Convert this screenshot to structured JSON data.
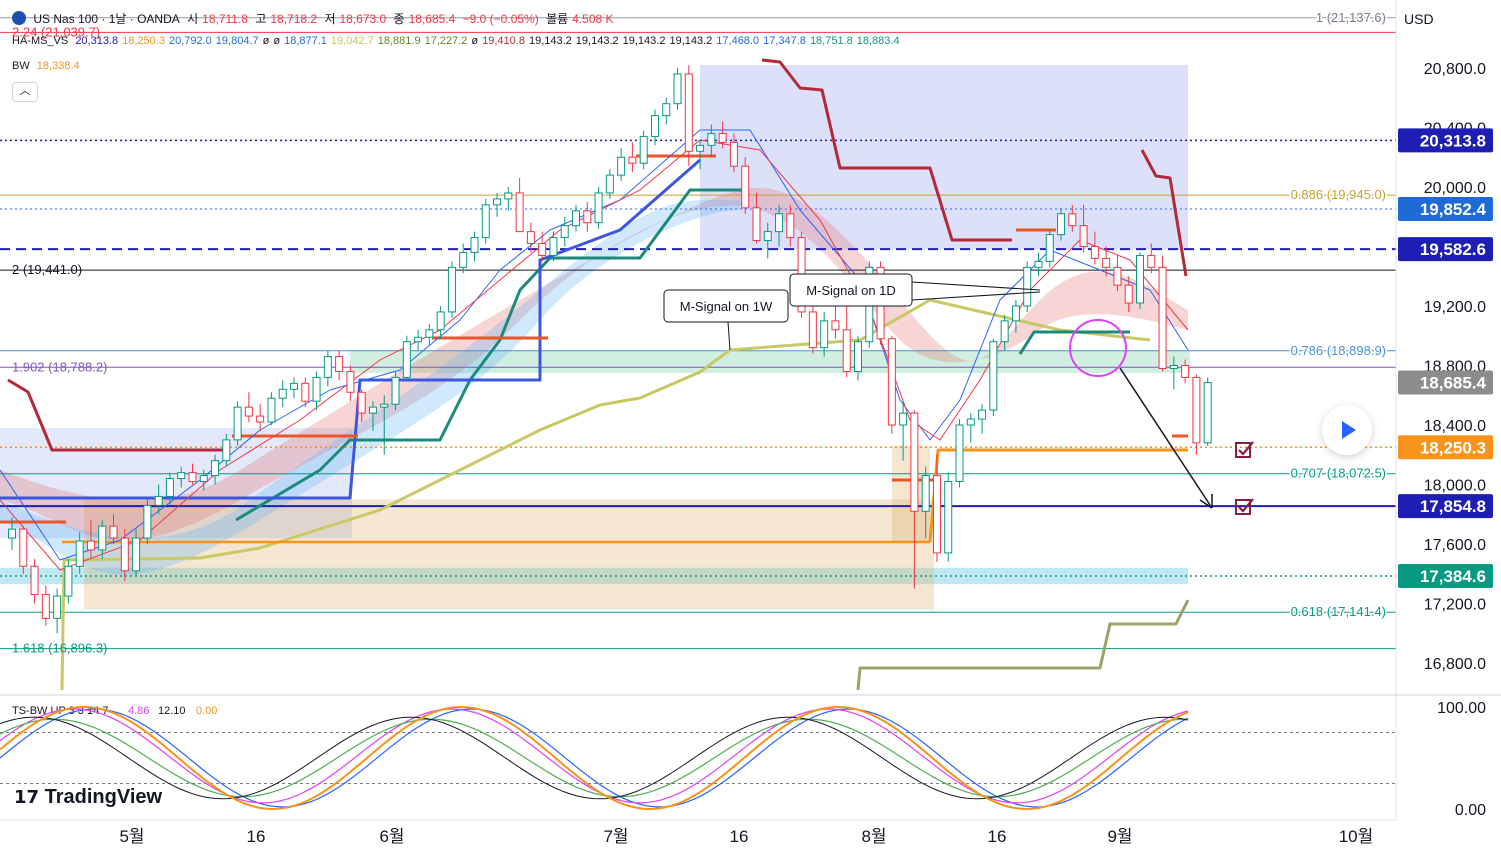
{
  "header": {
    "symbol": "US Nas 100 · 1날 · OANDA",
    "ohlc": [
      {
        "label": "시",
        "value": "18,711.8"
      },
      {
        "label": "고",
        "value": "18,718.2"
      },
      {
        "label": "저",
        "value": "18,673.0"
      },
      {
        "label": "종",
        "value": "18,685.4"
      }
    ],
    "change": "−9.0 (−0.05%)",
    "volume_label": "볼륨",
    "volume": "4.508 K",
    "indicator_rows": [
      {
        "name": "HA-MS_VS",
        "values": [
          "20,313.8",
          "18,250.3",
          "20,792.0",
          "19,804.7",
          "ø",
          "ø",
          "18,877.1",
          "19,042.7",
          "18,881.9",
          "17,227.2",
          "ø",
          "19,410.8",
          "19,143.2",
          "19,143.2",
          "19,143.2",
          "19,143.2",
          "17,468.0",
          "17,347.8",
          "18,751.8",
          "18,883.4"
        ]
      },
      {
        "name": "BW",
        "values": [
          "18,338.4"
        ]
      }
    ]
  },
  "currency": "USD",
  "logo_text": "TradingView",
  "colors": {
    "up": "#089981",
    "down": "#f23645",
    "blue_line": "#2962ff",
    "navy": "#1e1eb4",
    "orange": "#f7931a",
    "olive": "#c8c864",
    "teal": "#1b8a7a",
    "darkred": "#b22a38",
    "magenta": "#e040fb"
  },
  "chart_data": [
    {
      "type": "candlestick",
      "title": "US Nas 100 · 1날 · OANDA",
      "ylim": [
        16600,
        21200
      ],
      "x_tick_labels": [
        "5월",
        "16",
        "6월",
        "7월",
        "16",
        "8월",
        "16",
        "9월",
        "10월"
      ],
      "y_tick_labels": [
        "20,800.0",
        "20,400.0",
        "20,000.0",
        "19,200.0",
        "18,800.0",
        "18,400.0",
        "18,000.0",
        "17,600.0",
        "17,200.0",
        "16,800.0"
      ],
      "y_ticks": [
        20800,
        20400,
        20000,
        19200,
        18800,
        18400,
        18000,
        17600,
        17200,
        16800
      ],
      "price_tags": [
        {
          "label": "20,313.8",
          "value": 20313.8,
          "color": "#1e1eb4"
        },
        {
          "label": "19,852.4",
          "value": 19852.4,
          "color": "#1e6bd6"
        },
        {
          "label": "19,582.6",
          "value": 19582.6,
          "color": "#1e1eb4"
        },
        {
          "label": "18,685.4",
          "value": 18685.4,
          "color": "#8c8c8c"
        },
        {
          "label": "18,250.3",
          "value": 18250.3,
          "color": "#f7931a"
        },
        {
          "label": "17,854.8",
          "value": 17854.8,
          "color": "#1e1eb4"
        },
        {
          "label": "17,384.6",
          "value": 17384.6,
          "color": "#089981"
        }
      ],
      "fib_labels": [
        {
          "label": "1 (21,137.6)",
          "value": 21137.6
        },
        {
          "label": "2.24 (21,039.7)",
          "value": 21039.7
        },
        {
          "label": "0.886 (19,945.0)",
          "value": 19945.0
        },
        {
          "label": "2 (19,441.0)",
          "value": 19441.0
        },
        {
          "label": "0.786 (18,898.9)",
          "value": 18898.9
        },
        {
          "label": "1.902 (18,788.2)",
          "value": 18788.2
        },
        {
          "label": "0.707 (18,072.5)",
          "value": 18072.5
        },
        {
          "label": "0.618 (17,141.4)",
          "value": 17141.4
        },
        {
          "label": "1.618 (16,896.3)",
          "value": 16896.3
        }
      ],
      "annotations": [
        "M-Signal on 1W",
        "M-Signal on 1D"
      ],
      "candles": [
        [
          17640,
          17780,
          17560,
          17700
        ],
        [
          17700,
          17720,
          17400,
          17450
        ],
        [
          17450,
          17500,
          17200,
          17260
        ],
        [
          17260,
          17320,
          17050,
          17100
        ],
        [
          17100,
          17300,
          17000,
          17250
        ],
        [
          17250,
          17500,
          17200,
          17450
        ],
        [
          17450,
          17680,
          17400,
          17620
        ],
        [
          17620,
          17760,
          17500,
          17560
        ],
        [
          17560,
          17760,
          17500,
          17720
        ],
        [
          17720,
          17800,
          17600,
          17640
        ],
        [
          17640,
          17700,
          17350,
          17420
        ],
        [
          17420,
          17700,
          17380,
          17640
        ],
        [
          17640,
          17900,
          17600,
          17860
        ],
        [
          17860,
          18000,
          17800,
          17920
        ],
        [
          17920,
          18080,
          17860,
          18040
        ],
        [
          18040,
          18120,
          17980,
          18080
        ],
        [
          18080,
          18140,
          18000,
          18020
        ],
        [
          18020,
          18100,
          17960,
          18060
        ],
        [
          18060,
          18200,
          18000,
          18160
        ],
        [
          18160,
          18340,
          18120,
          18300
        ],
        [
          18300,
          18560,
          18260,
          18520
        ],
        [
          18520,
          18620,
          18420,
          18460
        ],
        [
          18460,
          18540,
          18360,
          18420
        ],
        [
          18420,
          18620,
          18400,
          18580
        ],
        [
          18580,
          18700,
          18520,
          18640
        ],
        [
          18640,
          18720,
          18580,
          18680
        ],
        [
          18680,
          18720,
          18520,
          18560
        ],
        [
          18560,
          18760,
          18500,
          18720
        ],
        [
          18720,
          18900,
          18660,
          18860
        ],
        [
          18860,
          18900,
          18700,
          18760
        ],
        [
          18760,
          18800,
          18560,
          18620
        ],
        [
          18620,
          18640,
          18420,
          18480
        ],
        [
          18480,
          18560,
          18360,
          18520
        ],
        [
          18520,
          18600,
          18200,
          18540
        ],
        [
          18540,
          18760,
          18500,
          18720
        ],
        [
          18720,
          19000,
          18700,
          18960
        ],
        [
          18960,
          19040,
          18900,
          18990
        ],
        [
          18990,
          19080,
          18940,
          19040
        ],
        [
          19040,
          19200,
          18980,
          19160
        ],
        [
          19160,
          19500,
          19120,
          19460
        ],
        [
          19460,
          19620,
          19420,
          19560
        ],
        [
          19560,
          19700,
          19500,
          19660
        ],
        [
          19660,
          19920,
          19620,
          19880
        ],
        [
          19880,
          19960,
          19800,
          19920
        ],
        [
          19920,
          20000,
          19840,
          19960
        ],
        [
          19960,
          20060,
          19880,
          19700
        ],
        [
          19700,
          19760,
          19560,
          19620
        ],
        [
          19620,
          19700,
          19500,
          19540
        ],
        [
          19540,
          19700,
          19500,
          19660
        ],
        [
          19660,
          19800,
          19600,
          19740
        ],
        [
          19740,
          19880,
          19700,
          19840
        ],
        [
          19840,
          19900,
          19700,
          19760
        ],
        [
          19760,
          20000,
          19720,
          19960
        ],
        [
          19960,
          20120,
          19920,
          20080
        ],
        [
          20080,
          20260,
          20040,
          20200
        ],
        [
          20200,
          20300,
          20100,
          20160
        ],
        [
          20160,
          20380,
          20120,
          20340
        ],
        [
          20340,
          20520,
          20280,
          20480
        ],
        [
          20480,
          20600,
          20420,
          20560
        ],
        [
          20560,
          20800,
          20520,
          20760
        ],
        [
          20760,
          20820,
          20140,
          20240
        ],
        [
          20240,
          20320,
          20120,
          20280
        ],
        [
          20280,
          20420,
          20200,
          20360
        ],
        [
          20360,
          20440,
          20260,
          20300
        ],
        [
          20300,
          20360,
          20100,
          20140
        ],
        [
          20140,
          20200,
          19820,
          19860
        ],
        [
          19860,
          19960,
          19620,
          19640
        ],
        [
          19640,
          19760,
          19520,
          19700
        ],
        [
          19700,
          19880,
          19600,
          19820
        ],
        [
          19820,
          19880,
          19600,
          19660
        ],
        [
          19660,
          19700,
          19120,
          19160
        ],
        [
          19160,
          19220,
          18880,
          18920
        ],
        [
          18920,
          19160,
          18860,
          19100
        ],
        [
          19100,
          19260,
          18980,
          19040
        ],
        [
          19040,
          19200,
          18720,
          18760
        ],
        [
          18760,
          19000,
          18700,
          18960
        ],
        [
          18960,
          19500,
          18920,
          19460
        ],
        [
          19460,
          19500,
          18940,
          18980
        ],
        [
          18980,
          19000,
          18340,
          18400
        ],
        [
          18400,
          18560,
          18160,
          18480
        ],
        [
          18480,
          18500,
          17300,
          17820
        ],
        [
          17820,
          18120,
          17640,
          18060
        ],
        [
          18060,
          18200,
          17480,
          17540
        ],
        [
          17540,
          18080,
          17480,
          18020
        ],
        [
          18020,
          18440,
          17980,
          18400
        ],
        [
          18400,
          18480,
          18280,
          18440
        ],
        [
          18440,
          18540,
          18340,
          18500
        ],
        [
          18500,
          18980,
          18460,
          18960
        ],
        [
          18960,
          19140,
          18900,
          19100
        ],
        [
          19100,
          19240,
          19020,
          19200
        ],
        [
          19200,
          19500,
          19160,
          19460
        ],
        [
          19460,
          19560,
          19400,
          19500
        ],
        [
          19500,
          19720,
          19460,
          19680
        ],
        [
          19680,
          19860,
          19640,
          19820
        ],
        [
          19820,
          19880,
          19700,
          19740
        ],
        [
          19740,
          19880,
          19560,
          19600
        ],
        [
          19600,
          19700,
          19480,
          19520
        ],
        [
          19520,
          19600,
          19400,
          19460
        ],
        [
          19460,
          19540,
          19300,
          19340
        ],
        [
          19340,
          19400,
          19160,
          19220
        ],
        [
          19220,
          19560,
          19180,
          19540
        ],
        [
          19540,
          19620,
          19420,
          19460
        ],
        [
          19460,
          19540,
          18760,
          18780
        ],
        [
          18780,
          18860,
          18640,
          18800
        ],
        [
          18800,
          18840,
          18680,
          18720
        ],
        [
          18720,
          18740,
          18200,
          18280
        ],
        [
          18280,
          18720,
          18260,
          18685.4
        ]
      ]
    },
    {
      "type": "line",
      "title": "TS-BW UP 3 3 14 7",
      "values_shown": [
        "4.86",
        "12.10",
        "0.00"
      ],
      "ylim": [
        0,
        100
      ],
      "y_tick_labels": [
        "100.00",
        "0.00"
      ]
    }
  ]
}
